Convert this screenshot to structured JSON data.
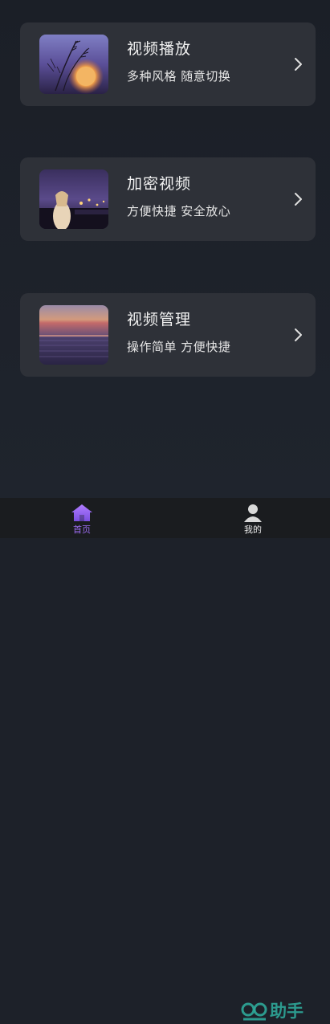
{
  "cards": [
    {
      "title": "视频播放",
      "subtitle": "多种风格 随意切换",
      "thumb_icon": "dandelion-sunset-thumbnail",
      "chevron_icon": "chevron-right-icon"
    },
    {
      "title": "加密视频",
      "subtitle": "方便快捷 安全放心",
      "thumb_icon": "night-city-woman-thumbnail",
      "chevron_icon": "chevron-right-icon"
    },
    {
      "title": "视频管理",
      "subtitle": "操作简单 方便快捷",
      "thumb_icon": "sea-sunset-thumbnail",
      "chevron_icon": "chevron-right-icon"
    }
  ],
  "tabbar": {
    "home": {
      "label": "首页",
      "icon": "home-icon",
      "active": true
    },
    "mine": {
      "label": "我的",
      "icon": "user-icon",
      "active": false
    }
  },
  "watermark": {
    "text": "助手"
  },
  "colors": {
    "background": "#1d2129",
    "card": "#2e3138",
    "tabbar": "#1a1c1f",
    "accent": "#9b6cf0",
    "watermark": "#2fb0a0"
  }
}
